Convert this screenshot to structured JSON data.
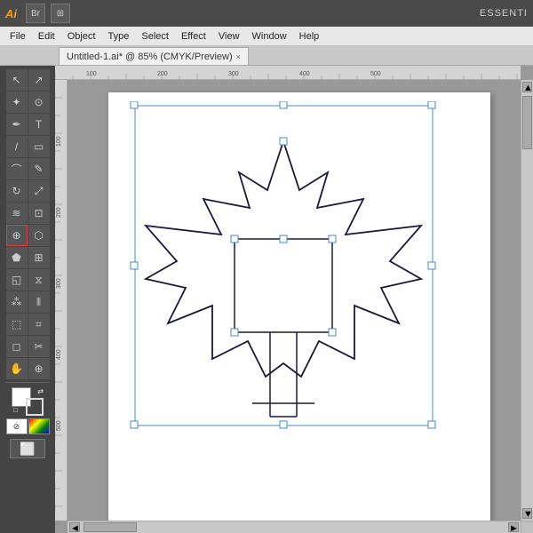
{
  "topbar": {
    "ai_logo": "Ai",
    "essential_label": "ESSENTI",
    "br_btn": "Br",
    "grid_btn": "⊞"
  },
  "menubar": {
    "items": [
      "File",
      "Edit",
      "Object",
      "Type",
      "Select",
      "Effect",
      "View",
      "Window",
      "Help"
    ]
  },
  "tab": {
    "title": "Untitled-1.ai* @ 85% (CMYK/Preview)",
    "close": "×"
  },
  "toolbar": {
    "tools": [
      {
        "id": "selection",
        "icon": "↖",
        "active": false
      },
      {
        "id": "direct-selection",
        "icon": "↗",
        "active": false
      },
      {
        "id": "magic-wand",
        "icon": "✦",
        "active": false
      },
      {
        "id": "lasso",
        "icon": "⊙",
        "active": false
      },
      {
        "id": "pen",
        "icon": "✒",
        "active": false
      },
      {
        "id": "text",
        "icon": "T",
        "active": false
      },
      {
        "id": "line",
        "icon": "/",
        "active": false
      },
      {
        "id": "rect",
        "icon": "▭",
        "active": false
      },
      {
        "id": "brush",
        "icon": "⌒",
        "active": false
      },
      {
        "id": "pencil",
        "icon": "✎",
        "active": false
      },
      {
        "id": "rotate",
        "icon": "↻",
        "active": false
      },
      {
        "id": "scale",
        "icon": "⤢",
        "active": false
      },
      {
        "id": "warp",
        "icon": "≋",
        "active": false
      },
      {
        "id": "free-transform",
        "icon": "⊡",
        "active": false
      },
      {
        "id": "shape-builder",
        "icon": "⊕",
        "active": false
      },
      {
        "id": "live-paint",
        "icon": "⬡",
        "active": false
      },
      {
        "id": "perspective",
        "icon": "⬟",
        "active": false
      },
      {
        "id": "mesh",
        "icon": "⊞",
        "active": false
      },
      {
        "id": "gradient",
        "icon": "◱",
        "active": false
      },
      {
        "id": "blend",
        "icon": "⧖",
        "active": false
      },
      {
        "id": "symbol-spray",
        "icon": "⁂",
        "active": false
      },
      {
        "id": "column-graph",
        "icon": "⦀",
        "active": false
      },
      {
        "id": "artboard",
        "icon": "⬚",
        "active": false
      },
      {
        "id": "slice",
        "icon": "⌗",
        "active": false
      },
      {
        "id": "eraser",
        "icon": "◻",
        "active": false
      },
      {
        "id": "scissors",
        "icon": "✂",
        "active": false
      },
      {
        "id": "hand",
        "icon": "✋",
        "active": false
      },
      {
        "id": "zoom",
        "icon": "🔍",
        "active": false
      },
      {
        "id": "perspective-grid",
        "icon": "◈",
        "active": true
      }
    ]
  },
  "canvas": {
    "tab_title": "Untitled-1.ai* @ 85% (CMYK/Preview)"
  },
  "status": {
    "zoom": "85%",
    "mode": "CMYK/Preview"
  }
}
